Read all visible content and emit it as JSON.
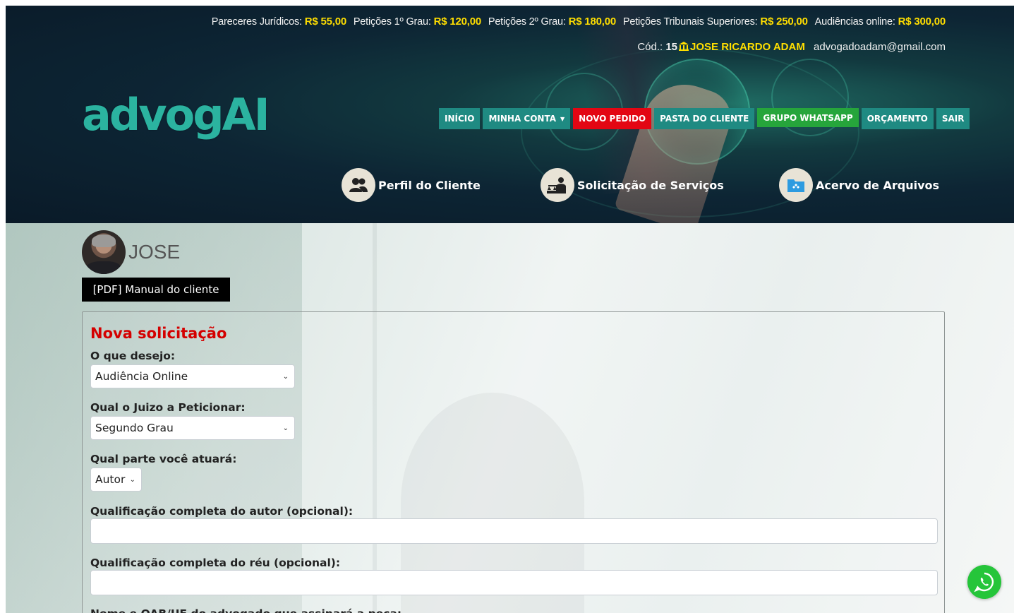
{
  "prices": [
    {
      "label": "Pareceres Jurídicos:",
      "value": "R$ 55,00"
    },
    {
      "label": "Petições 1º Grau:",
      "value": "R$ 120,00"
    },
    {
      "label": "Petições 2º Grau:",
      "value": "R$ 180,00"
    },
    {
      "label": "Petições Tribunais Superiores:",
      "value": "R$ 250,00"
    },
    {
      "label": "Audiências online:",
      "value": "R$ 300,00"
    }
  ],
  "user": {
    "code_label": "Cód.:",
    "code": "15",
    "name": "JOSE RICARDO ADAM",
    "email": "advogadoadam@gmail.com"
  },
  "logo": "advogAI",
  "nav": [
    {
      "label": "INÍCIO"
    },
    {
      "label": "MINHA CONTA"
    },
    {
      "label": "NOVO PEDIDO"
    },
    {
      "label": "PASTA DO CLIENTE"
    },
    {
      "label": "GRUPO WHATSAPP"
    },
    {
      "label": "ORÇAMENTO"
    },
    {
      "label": "SAIR"
    }
  ],
  "quick_links": [
    {
      "label": "Perfil do Cliente",
      "icon": "users-icon"
    },
    {
      "label": "Solicitação de Serviços",
      "icon": "justice-icon"
    },
    {
      "label": "Acervo de Arquivos",
      "icon": "folder-icon"
    }
  ],
  "profile": {
    "name": "JOSE"
  },
  "manual_button": "[PDF] Manual do cliente",
  "form": {
    "title": "Nova solicitação",
    "desire_label": "O que desejo:",
    "desire_value": "Audiência Online",
    "court_label": "Qual o Juizo a Peticionar:",
    "court_value": "Segundo Grau",
    "party_label": "Qual parte você atuará:",
    "party_value": "Autor",
    "author_label": "Qualificação completa do autor (opcional):",
    "author_value": "",
    "defendant_label": "Qualificação completa do réu (opcional):",
    "defendant_value": "",
    "lawyer_label": "Nome e OAB/UF do advogado que assinará a peça:"
  },
  "colors": {
    "nav_teal": "#1f8a82",
    "nav_red": "#e30613",
    "nav_green": "#26a53b",
    "price_yellow": "#ffde00",
    "title_red": "#d40000",
    "logo_teal": "#2bb3a0"
  }
}
